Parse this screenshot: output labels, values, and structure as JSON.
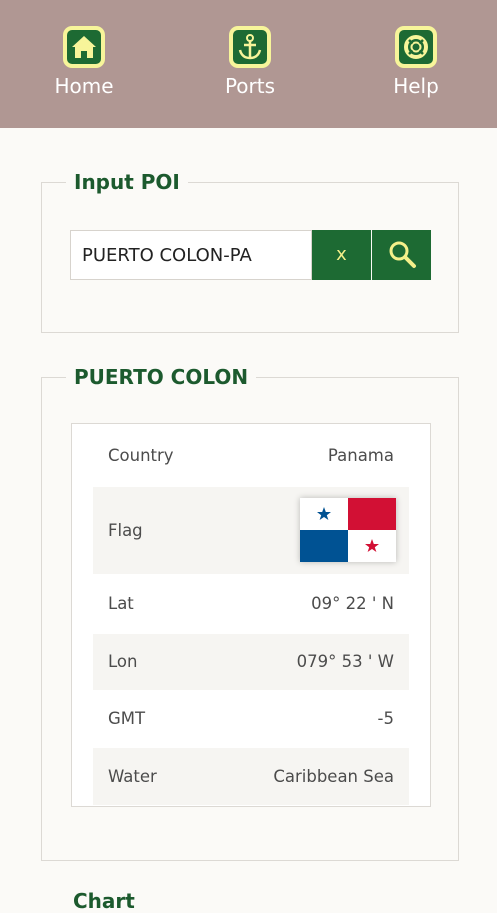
{
  "nav": {
    "items": [
      {
        "label": "Home",
        "icon": "home-icon"
      },
      {
        "label": "Ports",
        "icon": "anchor-icon"
      },
      {
        "label": "Help",
        "icon": "lifebuoy-icon"
      }
    ]
  },
  "poi_panel": {
    "legend": "Input POI",
    "input_value": "PUERTO COLON-PA",
    "clear_label": "x"
  },
  "port_panel": {
    "legend": "PUERTO COLON",
    "rows": [
      {
        "key": "Country",
        "value": "Panama"
      },
      {
        "key": "Flag",
        "value": ""
      },
      {
        "key": "Lat",
        "value": "09° 22 ' N"
      },
      {
        "key": "Lon",
        "value": "079° 53 ' W"
      },
      {
        "key": "GMT",
        "value": "-5"
      },
      {
        "key": "Water",
        "value": "Caribbean Sea"
      }
    ]
  },
  "next_panel": {
    "legend": "Chart"
  },
  "colors": {
    "nav_bg": "#b09793",
    "icon_bg": "#f7f59a",
    "accent_green": "#1d6a33",
    "heading_green": "#1c5a2e"
  }
}
